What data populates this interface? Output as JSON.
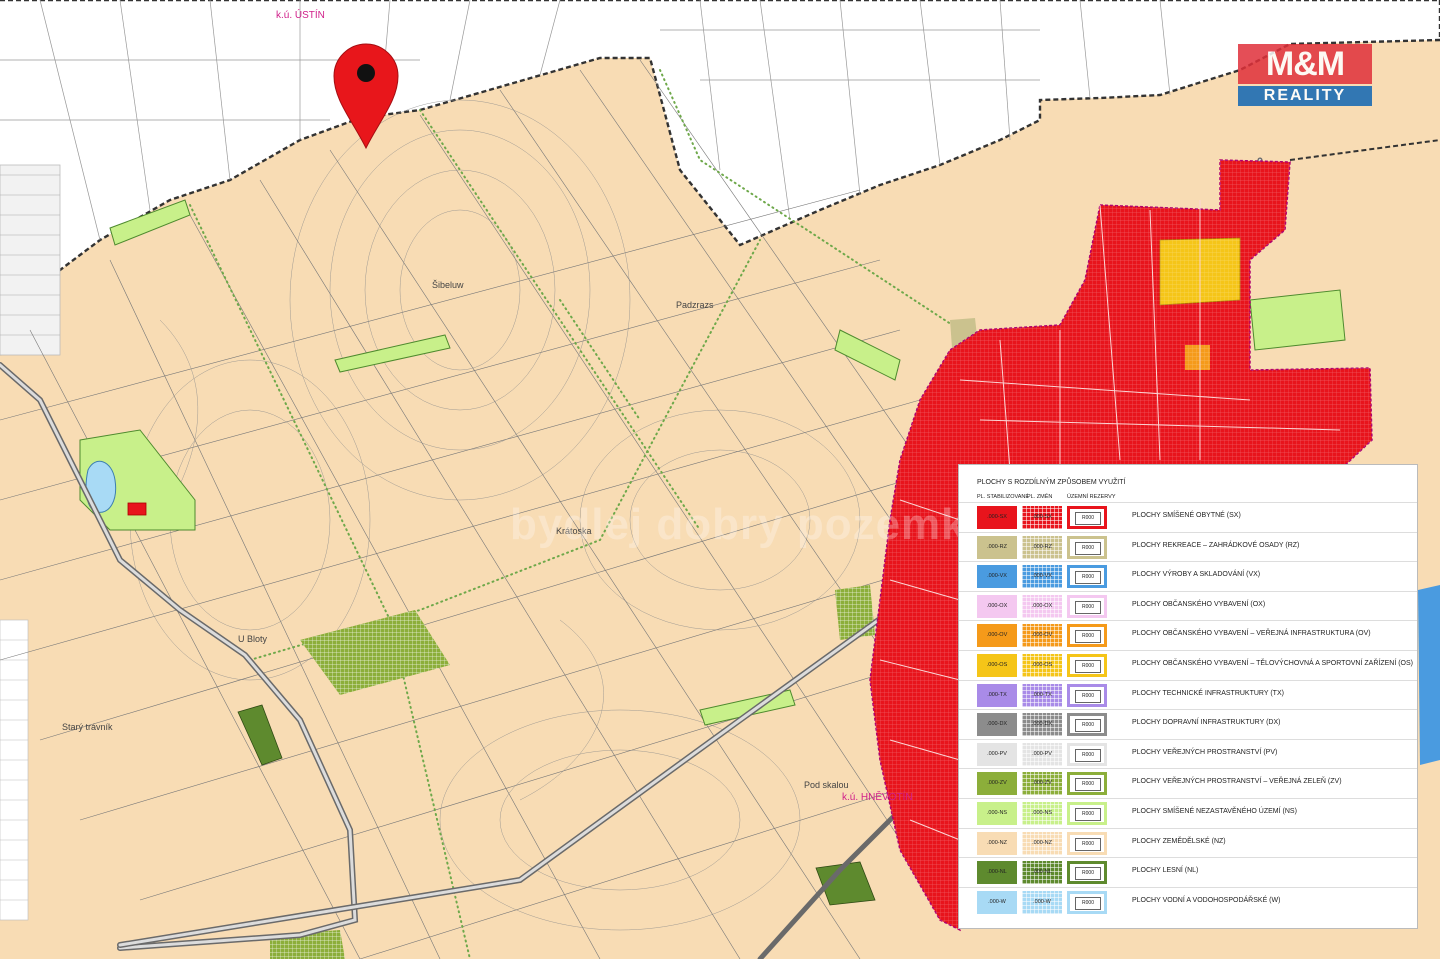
{
  "map": {
    "base_color": "#f8dcb4",
    "cadastral_labels": {
      "north": "k.ú. ÚSTÍN",
      "south": "k.ú. HNĚVOTÍN"
    },
    "place_names": [
      "Šibeluw",
      "Padzrazs",
      "Krátoska",
      "U Bloty",
      "Starý trávník",
      "Pod skalou"
    ],
    "marker": {
      "icon": "map-pin-icon",
      "color": "#e8161b"
    },
    "watermark": "bydlej dobry pozemky"
  },
  "logo": {
    "brand": "M&M",
    "sub": "REALITY",
    "colors": {
      "brand": "#e0303a",
      "sub": "#1d6db3"
    }
  },
  "legend": {
    "title": "PLOCHY S ROZDÍLNÝM ZPŮSOBEM VYUŽITÍ",
    "headers": {
      "stabilized": "PL. STABILIZOVANÉ",
      "changes": "PL. ZMĚN",
      "reserves": "ÚZEMNÍ REZERVY"
    },
    "reserve_code": "R000",
    "items": [
      {
        "code": ".000-SX",
        "code_change": ".000-SX",
        "label": "PLOCHY SMÍŠENÉ OBYTNÉ (SX)",
        "color": "#e8141c",
        "reserve_color": "#e8141c"
      },
      {
        "code": ".000-RZ",
        "code_change": ".000-RZ",
        "label": "PLOCHY REKREACE – ZAHRÁDKOVÉ OSADY (RZ)",
        "color": "#cbc28e",
        "reserve_color": "#cbc28e"
      },
      {
        "code": ".000-VX",
        "code_change": ".000-VX",
        "label": "PLOCHY VÝROBY A SKLADOVÁNÍ (VX)",
        "color": "#4a9be0",
        "reserve_color": "#4a9be0"
      },
      {
        "code": ".000-OX",
        "code_change": ".000-OX",
        "label": "PLOCHY OBČANSKÉHO VYBAVENÍ (OX)",
        "color": "#f4c8f0",
        "reserve_color": "#f4c8f0"
      },
      {
        "code": ".000-OV",
        "code_change": ".000-OV",
        "label": "PLOCHY OBČANSKÉHO VYBAVENÍ – VEŘEJNÁ INFRASTRUKTURA (OV)",
        "color": "#f59a1a",
        "reserve_color": "#f59a1a"
      },
      {
        "code": ".000-OS",
        "code_change": ".000-OS",
        "label": "PLOCHY OBČANSKÉHO VYBAVENÍ – TĚLOVÝCHOVNÁ A SPORTOVNÍ ZAŘÍZENÍ (OS)",
        "color": "#f5c518",
        "reserve_color": "#f5c518"
      },
      {
        "code": ".000-TX",
        "code_change": ".000-TX",
        "label": "PLOCHY TECHNICKÉ INFRASTRUKTURY (TX)",
        "color": "#a98be8",
        "reserve_color": "#a98be8"
      },
      {
        "code": ".000-DX",
        "code_change": ".000-DX",
        "label": "PLOCHY DOPRAVNÍ INFRASTRUKTURY (DX)",
        "color": "#8c8c8c",
        "reserve_color": "#8c8c8c"
      },
      {
        "code": ".000-PV",
        "code_change": ".000-PV",
        "label": "PLOCHY VEŘEJNÝCH PROSTRANSTVÍ (PV)",
        "color": "#e4e4e4",
        "reserve_color": "#e4e4e4"
      },
      {
        "code": ".000-ZV",
        "code_change": ".000-ZV",
        "label": "PLOCHY VEŘEJNÝCH PROSTRANSTVÍ – VEŘEJNÁ ZELEŇ (ZV)",
        "color": "#8cae3a",
        "reserve_color": "#8cae3a"
      },
      {
        "code": ".000-NS",
        "code_change": ".000-NS",
        "label": "PLOCHY SMÍŠENÉ NEZASTAVĚNÉHO ÚZEMÍ (NS)",
        "color": "#c8f08a",
        "reserve_color": "#c8f08a"
      },
      {
        "code": ".000-NZ",
        "code_change": ".000-NZ",
        "label": "PLOCHY ZEMĚDĚLSKÉ (NZ)",
        "color": "#f8dcb4",
        "reserve_color": "#f8dcb4"
      },
      {
        "code": ".000-NL",
        "code_change": ".000-NL",
        "label": "PLOCHY LESNÍ (NL)",
        "color": "#5e8a2e",
        "reserve_color": "#5e8a2e"
      },
      {
        "code": ".000-W",
        "code_change": ".000-W",
        "label": "PLOCHY VODNÍ A VODOHOSPODÁŘSKÉ (W)",
        "color": "#a8daf5",
        "reserve_color": "#a8daf5"
      }
    ]
  }
}
